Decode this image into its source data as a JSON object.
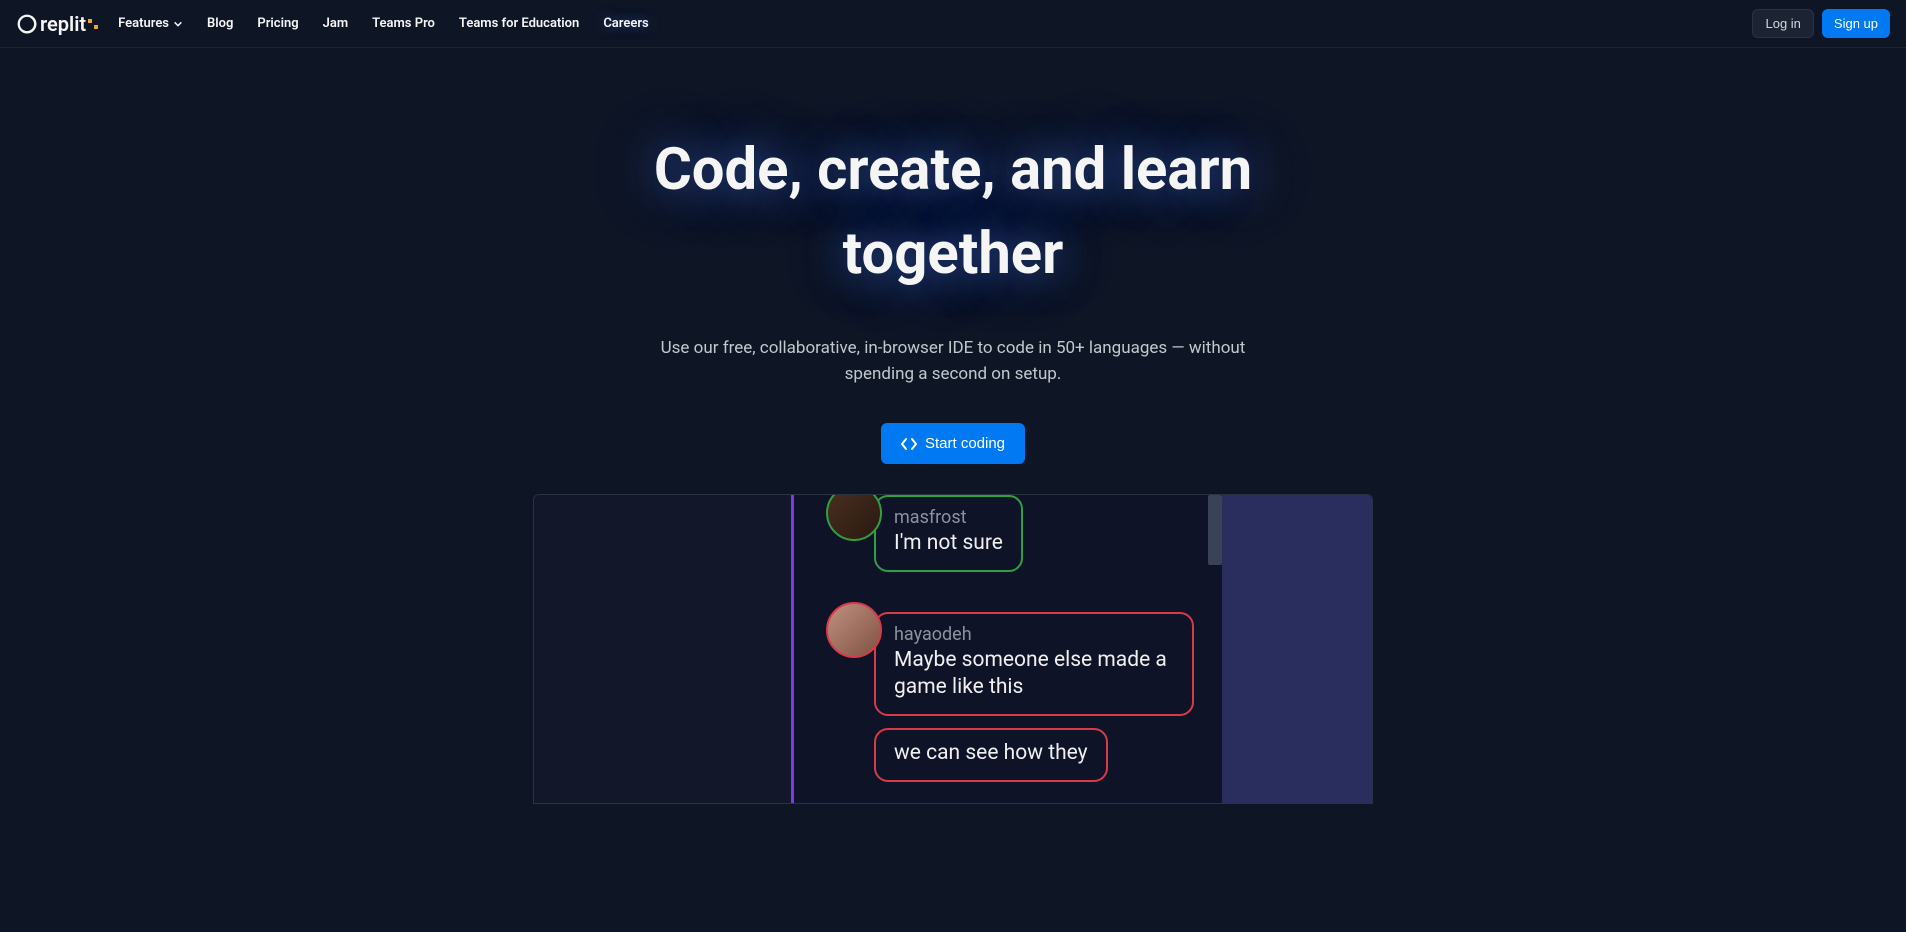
{
  "brand": "replit",
  "nav": {
    "features": "Features",
    "items": [
      "Blog",
      "Pricing",
      "Jam",
      "Teams Pro",
      "Teams for Education",
      "Careers"
    ]
  },
  "auth": {
    "login": "Log in",
    "signup": "Sign up"
  },
  "hero": {
    "title": "Code, create, and learn together",
    "subtitle": "Use our free, collaborative, in-browser IDE to code in 50+ languages — without spending a second on setup.",
    "cta": "Start coding"
  },
  "chat": [
    {
      "user": "masfrost",
      "text": "I'm not sure",
      "color": "green"
    },
    {
      "user": "hayaodeh",
      "text": "Maybe someone else made a game like this",
      "color": "red"
    },
    {
      "user": "",
      "text": "we can see how they",
      "color": "red"
    }
  ]
}
